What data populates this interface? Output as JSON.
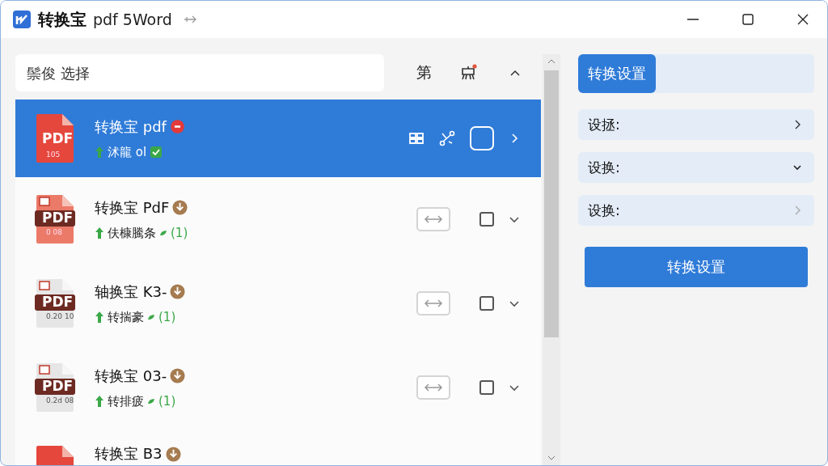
{
  "window": {
    "app_name": "转换宝",
    "title": "pdf 5Word"
  },
  "search": {
    "placeholder": "鬃俊 选择"
  },
  "toolbar": {
    "label": "第",
    "has_notification": true
  },
  "files": [
    {
      "name": "转换宝 pdf",
      "kind": "solid",
      "badge": "PDF",
      "size": "105",
      "status": "沭龍 ol",
      "selected": true,
      "checked": false
    },
    {
      "name": "转换宝 PdF",
      "kind": "banded",
      "badge": "PDF",
      "size": "0 08",
      "status": "伕槺騰条",
      "count": "(1)",
      "selected": false,
      "checked": false
    },
    {
      "name": "轴换宝 K3-",
      "kind": "pale",
      "badge": "PDF",
      "size": "0.20 10",
      "status": "转揣豪",
      "count": "(1)",
      "selected": false,
      "checked": false
    },
    {
      "name": "转换宝 03-",
      "kind": "pale",
      "badge": "PDF",
      "size": "0.2d 08",
      "status": "转排疲",
      "count": "(1)",
      "selected": false,
      "checked": false
    },
    {
      "name": "转换宝 B3",
      "kind": "solid",
      "partial": true,
      "selected": false
    }
  ],
  "settings": {
    "tab": "转换设置",
    "items": [
      {
        "label": "设拯:",
        "expanded": false,
        "disabled": false
      },
      {
        "label": "设换:",
        "expanded": true,
        "disabled": false
      },
      {
        "label": "设换:",
        "expanded": false,
        "disabled": true
      }
    ],
    "button": "转换设置"
  }
}
